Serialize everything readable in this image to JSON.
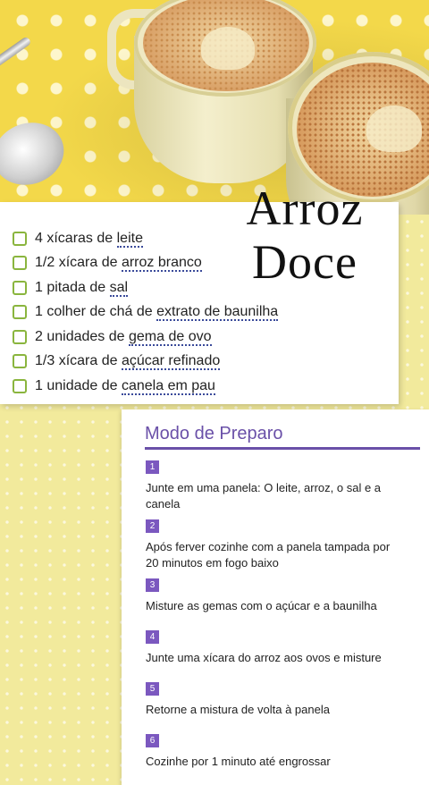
{
  "recipe": {
    "title_line1": "Arroz",
    "title_line2": "Doce"
  },
  "ingredients": [
    {
      "pre": "4 xícaras de ",
      "link": "leite",
      "post": ""
    },
    {
      "pre": "1/2 xícara de ",
      "link": "arroz branco",
      "post": ""
    },
    {
      "pre": "1 pitada de ",
      "link": "sal",
      "post": ""
    },
    {
      "pre": "1 colher de chá de ",
      "link": "extrato de baunilha",
      "post": ""
    },
    {
      "pre": "2 unidades de ",
      "link": "gema de ovo",
      "post": ""
    },
    {
      "pre": "1/3 xícara de ",
      "link": "açúcar refinado",
      "post": ""
    },
    {
      "pre": "1 unidade de ",
      "link": "canela em pau",
      "post": ""
    }
  ],
  "preparation": {
    "heading": "Modo de Preparo",
    "steps": [
      {
        "number": "1",
        "text": "Junte em uma panela: O leite, arroz, o sal e a canela"
      },
      {
        "number": "2",
        "text": "Após ferver cozinhe com a panela tampada por 20 minutos em fogo baixo"
      },
      {
        "number": "3",
        "text": "Misture as gemas com o açúcar e a baunilha"
      },
      {
        "number": "4",
        "text": "Junte uma xícara do arroz aos ovos e misture"
      },
      {
        "number": "5",
        "text": "Retorne a mistura de volta à panela"
      },
      {
        "number": "6",
        "text": "Cozinhe por 1 minuto até engrossar"
      }
    ]
  },
  "colors": {
    "accent_purple": "#6a50a8",
    "checkbox_green": "#8ab53e",
    "link_underline": "#3a4a9a",
    "background_yellow": "#f2ea9c"
  }
}
